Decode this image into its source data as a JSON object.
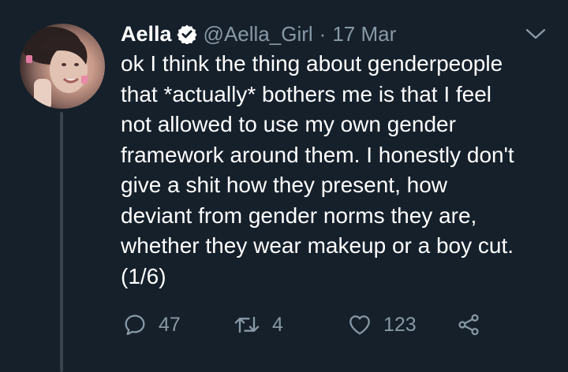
{
  "tweet": {
    "author_name": "Aella",
    "handle": "@Aella_Girl",
    "separator": "·",
    "date": "17 Mar",
    "body_lines": [
      "ok I think the thing about genderpeople",
      "that *actually* bothers me is that I feel",
      "not allowed to use my own gender",
      "framework around them. I honestly don't",
      "give a shit how they present, how",
      "deviant from gender norms they are,",
      "whether they wear makeup or a boy cut.",
      "(1/6)"
    ],
    "actions": {
      "replies": "47",
      "retweets": "4",
      "likes": "123"
    }
  },
  "icons": {
    "verified": "verified-badge-icon",
    "menu": "chevron-down-icon",
    "reply": "reply-icon",
    "retweet": "retweet-icon",
    "like": "heart-icon",
    "share": "share-icon"
  },
  "colors": {
    "background": "#15202b",
    "text": "#ffffff",
    "secondary": "#8899a6",
    "thread_line": "#38444d"
  }
}
